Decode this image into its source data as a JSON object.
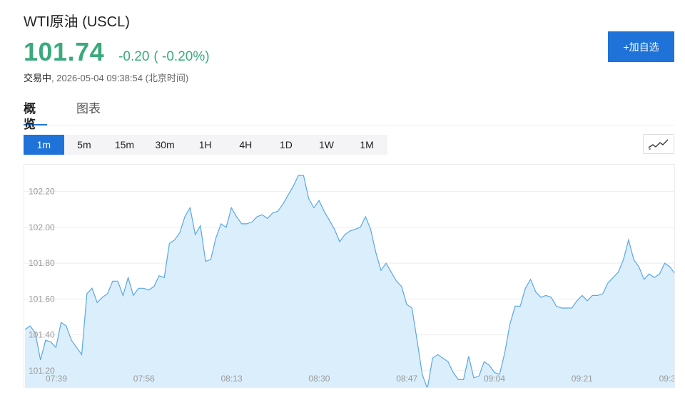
{
  "header": {
    "title": "WTI原油 (USCL)",
    "price": "101.74",
    "change": "-0.20",
    "change_pct": "( -0.20%)",
    "status": "交易中",
    "timestamp": "2026-05-04 09:38:54 (北京时间)",
    "add_button_label": "+加自选"
  },
  "tabs": [
    {
      "label": "概览",
      "active": true
    },
    {
      "label": "图表",
      "active": false
    }
  ],
  "intervals": [
    {
      "label": "1m",
      "active": true
    },
    {
      "label": "5m",
      "active": false
    },
    {
      "label": "15m",
      "active": false
    },
    {
      "label": "30m",
      "active": false
    },
    {
      "label": "1H",
      "active": false
    },
    {
      "label": "4H",
      "active": false
    },
    {
      "label": "1D",
      "active": false
    },
    {
      "label": "1W",
      "active": false
    },
    {
      "label": "1M",
      "active": false
    }
  ],
  "colors": {
    "up_green": "#3aaa7d",
    "accent_blue": "#1f73d8",
    "line": "#5aa7e6",
    "fill": "#dbeefb",
    "grid": "#eeeeee",
    "tick_text": "#999999"
  },
  "chart_data": {
    "type": "area",
    "ylim": [
      101.1,
      102.35
    ],
    "yticks": [
      "101.20",
      "101.40",
      "101.60",
      "101.80",
      "102.00",
      "102.20"
    ],
    "xticks": [
      "07:39",
      "07:56",
      "08:13",
      "08:30",
      "08:47",
      "09:04",
      "09:21",
      "09:3"
    ],
    "grid": true,
    "series": [
      {
        "values": [
          101.43,
          101.45,
          101.41,
          101.26,
          101.37,
          101.36,
          101.33,
          101.47,
          101.45,
          101.37,
          101.33,
          101.29,
          101.63,
          101.66,
          101.58,
          101.61,
          101.63,
          101.7,
          101.7,
          101.62,
          101.72,
          101.62,
          101.66,
          101.66,
          101.65,
          101.67,
          101.73,
          101.72,
          101.91,
          101.93,
          101.97,
          102.06,
          102.11,
          101.96,
          102.01,
          101.81,
          101.82,
          101.94,
          102.02,
          102.0,
          102.11,
          102.06,
          102.02,
          102.02,
          102.03,
          102.06,
          102.07,
          102.05,
          102.08,
          102.09,
          102.13,
          102.18,
          102.23,
          102.29,
          102.29,
          102.16,
          102.11,
          102.15,
          102.09,
          102.04,
          101.99,
          101.92,
          101.96,
          101.98,
          101.99,
          102.0,
          102.06,
          101.99,
          101.86,
          101.76,
          101.8,
          101.75,
          101.7,
          101.67,
          101.57,
          101.55,
          101.37,
          101.18,
          101.1,
          101.27,
          101.29,
          101.27,
          101.25,
          101.19,
          101.15,
          101.15,
          101.28,
          101.16,
          101.17,
          101.25,
          101.23,
          101.19,
          101.18,
          101.3,
          101.46,
          101.56,
          101.56,
          101.66,
          101.71,
          101.64,
          101.61,
          101.62,
          101.61,
          101.56,
          101.55,
          101.55,
          101.55,
          101.59,
          101.62,
          101.59,
          101.62,
          101.62,
          101.63,
          101.69,
          101.72,
          101.75,
          101.82,
          101.93,
          101.82,
          101.78,
          101.71,
          101.74,
          101.72,
          101.74,
          101.8,
          101.78,
          101.74
        ]
      }
    ]
  }
}
